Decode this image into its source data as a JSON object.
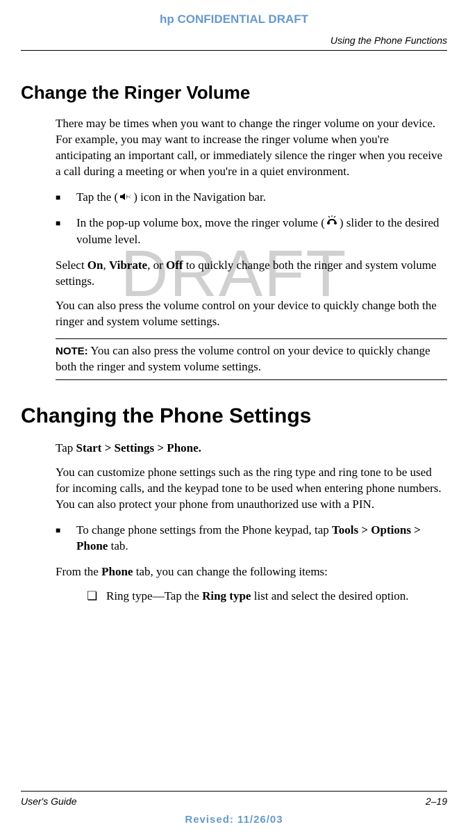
{
  "watermark": "DRAFT",
  "header": {
    "confidential": "hp CONFIDENTIAL DRAFT",
    "section": "Using the Phone Functions"
  },
  "section1": {
    "title": "Change the Ringer Volume",
    "intro": "There may be times when you want to change the ringer volume on your device. For example, you may want to increase the ringer volume when you're anticipating an important call, or immediately silence the ringer when you receive a call during a meeting or when you're in a quiet environment.",
    "bullet1_pre": "Tap the (",
    "bullet1_post": ") icon in the Navigation bar.",
    "bullet2_pre": "In the pop-up volume box, move the ringer volume (",
    "bullet2_post": ") slider to the desired volume level.",
    "para2_pre": "Select ",
    "para2_on": "On",
    "para2_c1": ", ",
    "para2_vib": "Vibrate",
    "para2_c2": ", or ",
    "para2_off": "Off",
    "para2_post": " to quickly change both the ringer and system volume settings.",
    "para3": "You can also press the volume control on your device to quickly change both the ringer and system volume settings.",
    "note_label": "NOTE:",
    "note_text": " You can also press the volume control on your device to quickly change both the ringer and system volume settings."
  },
  "section2": {
    "title": "Changing the Phone Settings",
    "para1_pre": "Tap ",
    "para1_bold": "Start > Settings > Phone.",
    "para2": "You can customize phone settings such as the ring type and ring tone to be used for incoming calls, and the keypad tone to be used when entering phone numbers. You can also protect your phone from unauthorized use with a PIN.",
    "bullet1_pre": "To change phone settings from the Phone keypad, tap ",
    "bullet1_bold": "Tools > Options > Phone",
    "bullet1_post": " tab.",
    "para3_pre": "From the ",
    "para3_bold": "Phone",
    "para3_post": " tab, you can change the following items:",
    "sub1_pre": "Ring type—Tap the ",
    "sub1_bold": "Ring type",
    "sub1_post": " list and select the desired option."
  },
  "footer": {
    "left": "User's Guide",
    "right": "2–19",
    "revised": "Revised: 11/26/03"
  }
}
